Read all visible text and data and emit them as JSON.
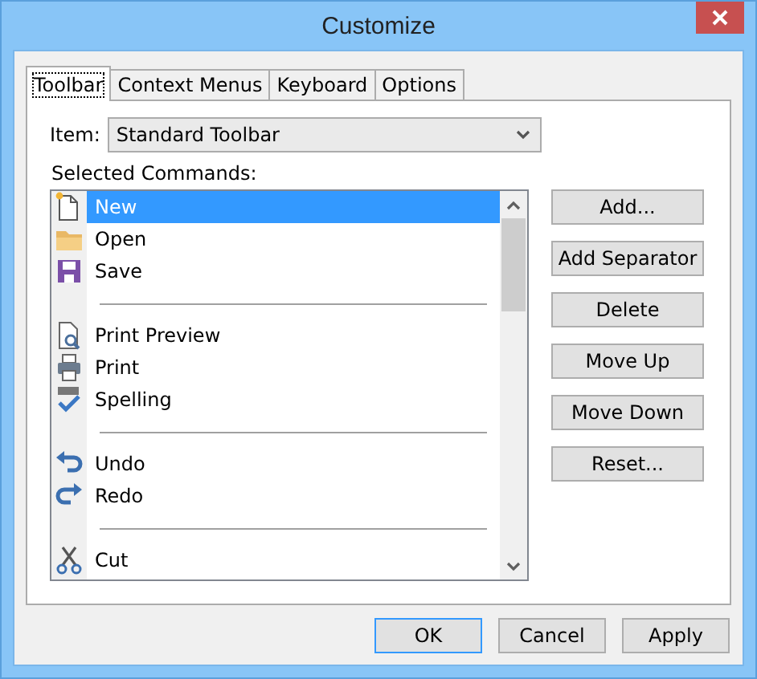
{
  "window": {
    "title": "Customize"
  },
  "tabs": [
    {
      "label": "Toolbar",
      "selected": true
    },
    {
      "label": "Context Menus",
      "selected": false
    },
    {
      "label": "Keyboard",
      "selected": false
    },
    {
      "label": "Options",
      "selected": false
    }
  ],
  "item": {
    "label": "Item:",
    "value": "Standard Toolbar"
  },
  "commands_label": {
    "label": "Selected Commands:"
  },
  "commands": [
    {
      "kind": "command",
      "label": "New",
      "selected": true
    },
    {
      "kind": "command",
      "label": "Open",
      "selected": false
    },
    {
      "kind": "command",
      "label": "Save",
      "selected": false
    },
    {
      "kind": "separator"
    },
    {
      "kind": "command",
      "label": "Print Preview",
      "selected": false
    },
    {
      "kind": "command",
      "label": "Print",
      "selected": false
    },
    {
      "kind": "command",
      "label": "Spelling",
      "selected": false
    },
    {
      "kind": "separator"
    },
    {
      "kind": "command",
      "label": "Undo",
      "selected": false
    },
    {
      "kind": "command",
      "label": "Redo",
      "selected": false
    },
    {
      "kind": "separator"
    },
    {
      "kind": "command",
      "label": "Cut",
      "selected": false
    }
  ],
  "side_buttons": [
    {
      "label": "Add..."
    },
    {
      "label": "Add Separator"
    },
    {
      "label": "Delete"
    },
    {
      "label": "Move Up"
    },
    {
      "label": "Move Down"
    },
    {
      "label": "Reset..."
    }
  ],
  "footer_buttons": [
    {
      "label": "OK",
      "default": true
    },
    {
      "label": "Cancel",
      "default": false
    },
    {
      "label": "Apply",
      "default": false
    }
  ]
}
